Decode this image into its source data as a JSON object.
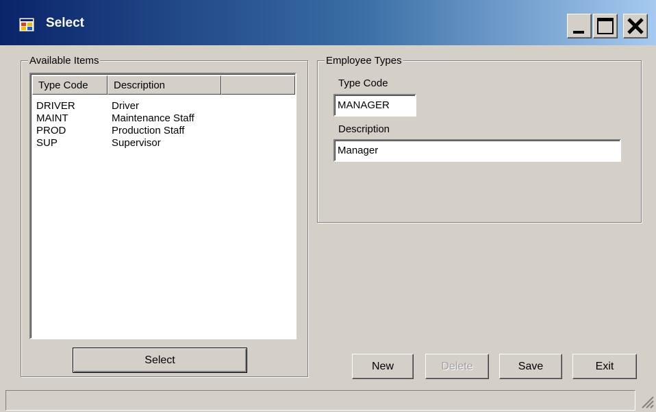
{
  "window": {
    "title": "Select",
    "controls": {
      "minimize": "minimize",
      "maximize": "maximize",
      "close": "close"
    }
  },
  "available_items": {
    "legend": "Available Items",
    "columns": [
      "Type Code",
      "Description",
      ""
    ],
    "rows": [
      {
        "code": "DRIVER",
        "description": "Driver"
      },
      {
        "code": "MAINT",
        "description": "Maintenance Staff"
      },
      {
        "code": "PROD",
        "description": "Production Staff"
      },
      {
        "code": "SUP",
        "description": "Supervisor"
      }
    ],
    "select_label": "Select"
  },
  "employee_types": {
    "legend": "Employee Types",
    "type_code_label": "Type Code",
    "type_code_value": "MANAGER",
    "description_label": "Description",
    "description_value": "Manager"
  },
  "actions": {
    "new_label": "New",
    "delete_label": "Delete",
    "save_label": "Save",
    "exit_label": "Exit"
  },
  "colors": {
    "title_gradient_start": "#0a246a",
    "title_gradient_end": "#a6caf0",
    "face": "#d4d0c8"
  }
}
